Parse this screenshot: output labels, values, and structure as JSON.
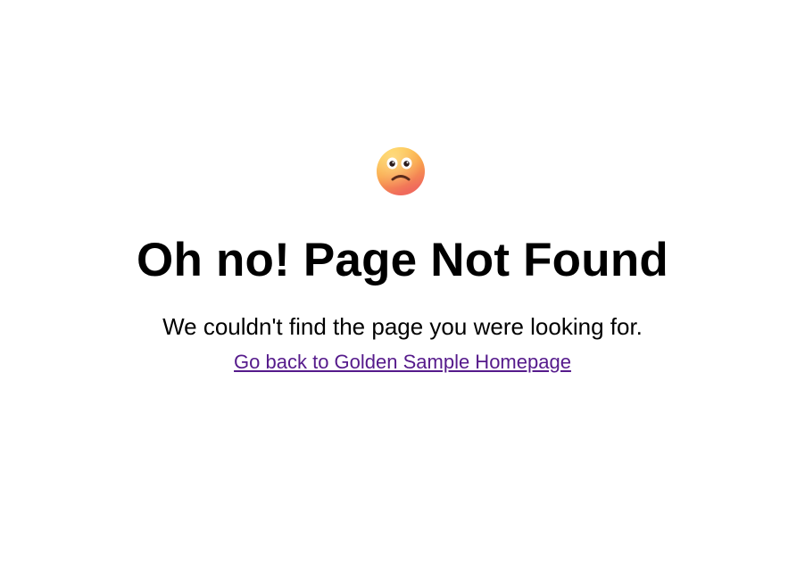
{
  "icon": {
    "name": "worried-face-icon",
    "colors": {
      "face_top": "#ffd24a",
      "face_bottom": "#f06b5c"
    }
  },
  "heading": "Oh no! Page Not Found",
  "message": "We couldn't find the page you were looking for.",
  "home_link": {
    "label": "Go back to Golden Sample Homepage",
    "color": "#551a8b"
  }
}
